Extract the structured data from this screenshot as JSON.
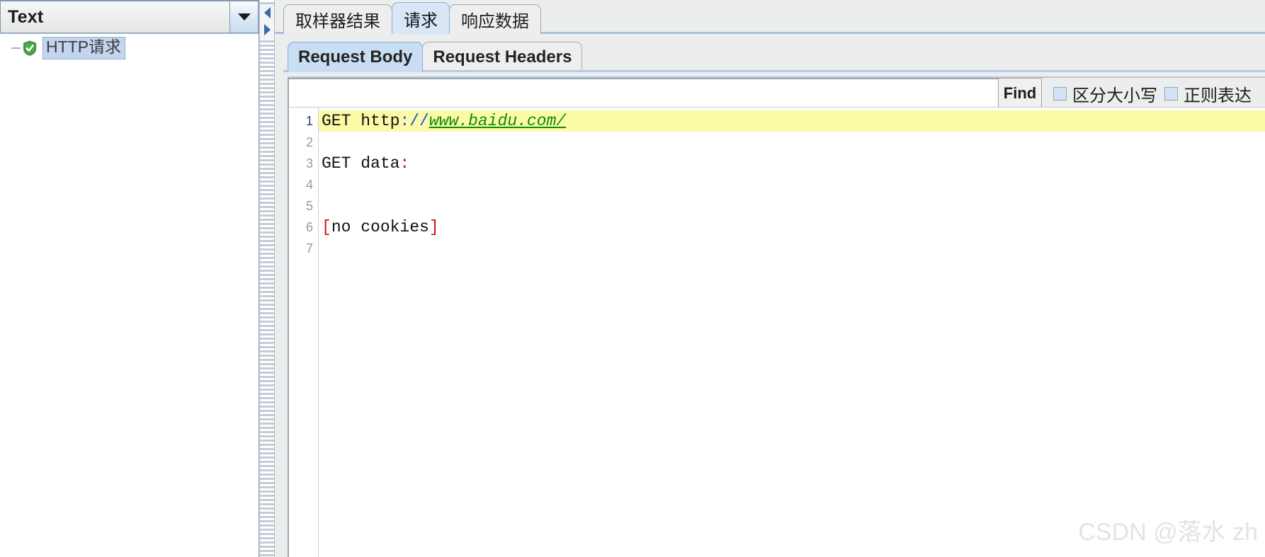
{
  "left_panel": {
    "combo": {
      "value": "Text",
      "icon": "chevron-down-icon"
    },
    "tree": {
      "items": [
        {
          "label": "HTTP请求",
          "icon": "green-shield-check-icon",
          "selected": true,
          "expanded": true
        }
      ]
    }
  },
  "splitter": {
    "collapse_left_icon": "triangle-left-icon",
    "collapse_right_icon": "triangle-right-icon"
  },
  "right_panel": {
    "tabs": [
      {
        "label": "取样器结果",
        "active": false
      },
      {
        "label": "请求",
        "active": true
      },
      {
        "label": "响应数据",
        "active": false
      }
    ],
    "subtabs": [
      {
        "label": "Request Body",
        "active": true
      },
      {
        "label": "Request Headers",
        "active": false
      }
    ],
    "findbar": {
      "input_value": "",
      "input_placeholder": "",
      "find_label": "Find",
      "checkboxes": [
        {
          "label": "区分大小写",
          "checked": false
        },
        {
          "label": "正则表达",
          "checked": false
        }
      ]
    },
    "editor": {
      "line_numbers": [
        "1",
        "2",
        "3",
        "4",
        "5",
        "6",
        "7"
      ],
      "current_line": 1,
      "lines": [
        {
          "n": 1,
          "highlighted": true,
          "tokens": [
            {
              "text": "GET http",
              "style": "black"
            },
            {
              "text": "://",
              "style": "blue"
            },
            {
              "text": "www.baidu.com/",
              "style": "green"
            }
          ]
        },
        {
          "n": 2,
          "highlighted": false,
          "tokens": []
        },
        {
          "n": 3,
          "highlighted": false,
          "tokens": [
            {
              "text": "GET data",
              "style": "black"
            },
            {
              "text": ":",
              "style": "red"
            }
          ]
        },
        {
          "n": 4,
          "highlighted": false,
          "tokens": []
        },
        {
          "n": 5,
          "highlighted": false,
          "tokens": []
        },
        {
          "n": 6,
          "highlighted": false,
          "tokens": [
            {
              "text": "[",
              "style": "red"
            },
            {
              "text": "no cookies",
              "style": "black"
            },
            {
              "text": "]",
              "style": "red"
            }
          ]
        },
        {
          "n": 7,
          "highlighted": false,
          "tokens": []
        }
      ]
    }
  },
  "watermark": {
    "text": "CSDN @落水 zh"
  },
  "colors": {
    "tab_active_bg": "#d8e6f6",
    "subtab_active_bg": "#c9ddf3",
    "selection_bg": "#c3d6ee",
    "line_highlight": "#fbfaa7",
    "url_green": "#0d8a0d",
    "punct_blue": "#1f4fcf",
    "punct_red": "#cc1111"
  }
}
